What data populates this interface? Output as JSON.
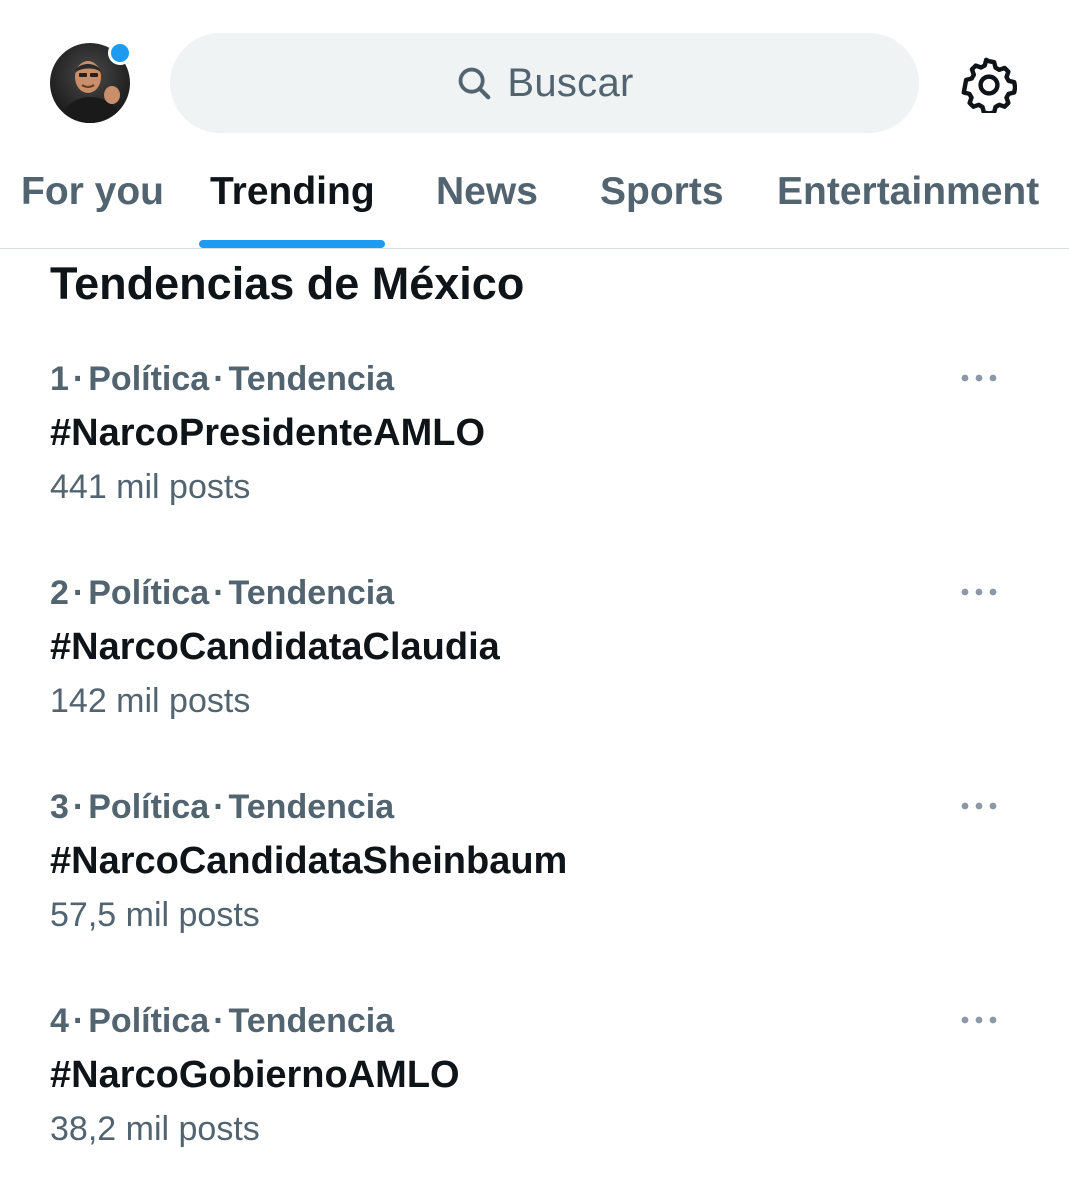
{
  "search": {
    "placeholder": "Buscar"
  },
  "tabs": [
    {
      "label": "For you",
      "active": false
    },
    {
      "label": "Trending",
      "active": true
    },
    {
      "label": "News",
      "active": false
    },
    {
      "label": "Sports",
      "active": false
    },
    {
      "label": "Entertainment",
      "active": false
    }
  ],
  "section": {
    "title": "Tendencias de México"
  },
  "trends": [
    {
      "rank": "1",
      "category": "Política",
      "kind": "Tendencia",
      "name": "#NarcoPresidenteAMLO",
      "posts": "441 mil posts"
    },
    {
      "rank": "2",
      "category": "Política",
      "kind": "Tendencia",
      "name": "#NarcoCandidataClaudia",
      "posts": "142 mil posts"
    },
    {
      "rank": "3",
      "category": "Política",
      "kind": "Tendencia",
      "name": "#NarcoCandidataSheinbaum",
      "posts": "57,5 mil posts"
    },
    {
      "rank": "4",
      "category": "Política",
      "kind": "Tendencia",
      "name": "#NarcoGobiernoAMLO",
      "posts": "38,2 mil posts"
    }
  ],
  "icons": {
    "avatar": "avatar",
    "notification_dot": "notification-dot",
    "search": "search-icon",
    "settings": "gear-icon",
    "more": "more-icon"
  },
  "colors": {
    "accent": "#1d9bf0",
    "text_primary": "#0f1419",
    "text_secondary": "#536471",
    "search_bg": "#eff3f4"
  }
}
